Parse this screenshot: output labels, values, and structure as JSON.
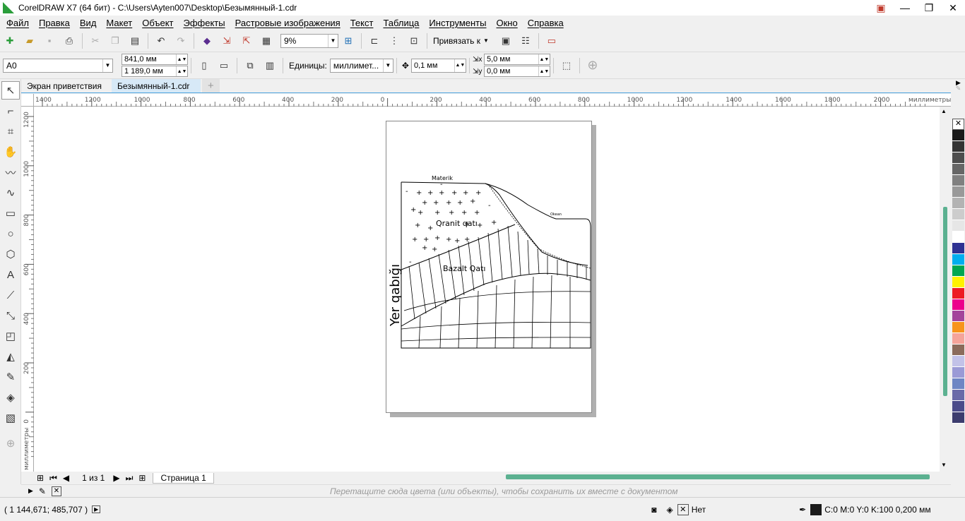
{
  "window": {
    "title": "CorelDRAW X7 (64 бит) - C:\\Users\\Ayten007\\Desktop\\Безымянный-1.cdr",
    "minimize": "—",
    "restore": "❐",
    "close": "✕"
  },
  "menu": [
    "Файл",
    "Правка",
    "Вид",
    "Макет",
    "Объект",
    "Эффекты",
    "Растровые изображения",
    "Текст",
    "Таблица",
    "Инструменты",
    "Окно",
    "Справка"
  ],
  "toolbar": {
    "zoom": "9%",
    "snap_label": "Привязать к"
  },
  "properties": {
    "page_size": "A0",
    "width": "841,0 мм",
    "height": "1 189,0 мм",
    "units_label": "Единицы:",
    "units": "миллимет...",
    "nudge": "0,1 мм",
    "dup_x": "5,0 мм",
    "dup_y": "0,0 мм"
  },
  "tabs": [
    "Экран приветствия",
    "Безымянный-1.cdr",
    "+"
  ],
  "rulers": {
    "h_ticks": [
      "1400",
      "1200",
      "1000",
      "800",
      "600",
      "400",
      "200",
      "0",
      "200",
      "400",
      "600",
      "800",
      "1000",
      "1200",
      "1400",
      "1600",
      "1800",
      "2000"
    ],
    "h_unit": "миллиметры",
    "v_ticks": [
      "1200",
      "1000",
      "800",
      "600",
      "400",
      "200",
      "0"
    ],
    "v_unit": "миллиметры"
  },
  "drawing": {
    "vertical_title": "Yer qabığı",
    "materik": "Materik",
    "okean": "Okean",
    "granite": "Qranit  qatı",
    "basalt": "Bazalt Qatı"
  },
  "pagebar": {
    "count": "1 из 1",
    "page_tab": "Страница 1"
  },
  "docpalette": {
    "hint": "Перетащите сюда цвета (или объекты), чтобы сохранить их вместе с документом"
  },
  "status": {
    "coords": "( 1 144,671; 485,707 )",
    "fill": "Нет",
    "outline": "C:0 M:0 Y:0 K:100  0,200 мм"
  },
  "palette": [
    "#ffffff",
    "#1a1a1a",
    "#333333",
    "#4d4d4d",
    "#666666",
    "#808080",
    "#999999",
    "#b3b3b3",
    "#cccccc",
    "#e6e6e6",
    "#ffffff",
    "#2e3192",
    "#00aeef",
    "#00a651",
    "#fff200",
    "#ed1c24",
    "#ec008c",
    "#a3449b",
    "#f7941d",
    "#f5a49a",
    "#8b6b5b",
    "#c2c2e8",
    "#9a9ad6",
    "#6e86c4",
    "#6a6aa8",
    "#4b4b8a",
    "#3c3c6e"
  ]
}
